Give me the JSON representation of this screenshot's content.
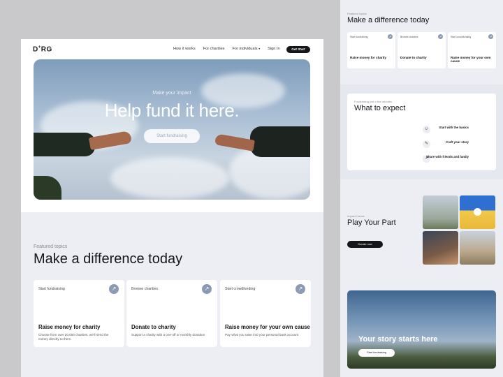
{
  "main": {
    "logo": "D",
    "logo_sup": "+",
    "logo_end": "RG",
    "nav": [
      "How it works",
      "For charities",
      "For individuals",
      "Sign In"
    ],
    "nav_dropdown_icon": "chevron-down-icon",
    "cta": "Get Start",
    "hero": {
      "subtitle": "Make your impact",
      "title": "Help fund it here.",
      "button": "Start fundraising"
    },
    "featured": {
      "label": "Featured topics",
      "title": "Make a difference today",
      "cards": [
        {
          "label": "Start fundraising",
          "title": "Raise money for charity",
          "desc": "Choose from over 20,000 charities, we'll send the money directly to them."
        },
        {
          "label": "Browse charities",
          "title": "Donate to charity",
          "desc": "Support a charity with a one-off or monthly donation"
        },
        {
          "label": "Start crowdfunding",
          "title": "Raise money for your own cause",
          "desc": "Pay what you raise into your personal bank account"
        }
      ]
    }
  },
  "side": {
    "topics": {
      "label": "Featured topics",
      "title": "Make a difference today",
      "cards": [
        {
          "label": "Start fundraising",
          "title": "Raise money for charity"
        },
        {
          "label": "Browse charities",
          "title": "Donate to charity"
        },
        {
          "label": "Start crowdfunding",
          "title": "Raise money for your own cause"
        }
      ]
    },
    "expect": {
      "label": "Fundraising just a few minutes",
      "title": "What to expect",
      "steps": [
        "Start with the basics",
        "Craft your story",
        "Share with friends and family"
      ]
    },
    "play": {
      "label": "Impact Cause",
      "title": "Play Your Part",
      "button": "Donate now"
    },
    "story": {
      "title": "Your story starts here",
      "button": "Start fundraising"
    }
  },
  "colors": {
    "accent": "#15161a",
    "arrow": "#8c9bb3",
    "panel": "#eceef3"
  }
}
